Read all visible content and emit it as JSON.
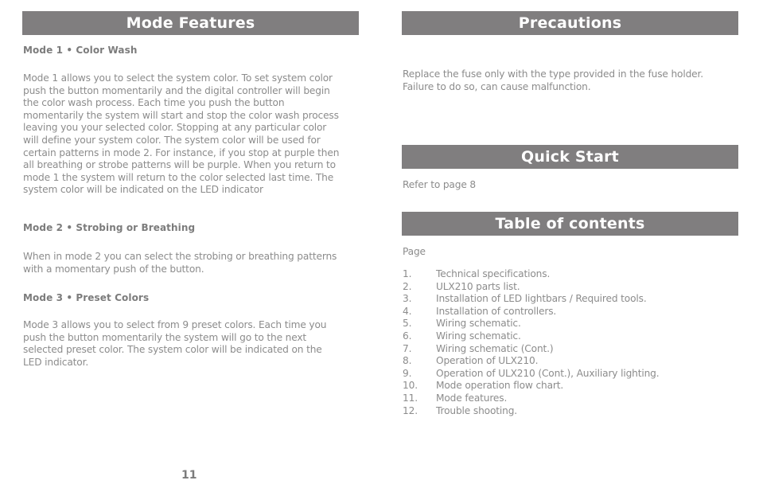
{
  "left_page": {
    "title": "Mode Features",
    "modes": [
      {
        "heading": "Mode 1 • Color Wash",
        "body": "Mode 1 allows you to select the system color. To set system color push the button momentarily and the digital controller will begin the color wash process. Each time you push the button momentarily the system will start and stop the color wash process leaving you your selected color. Stopping at any particular color will define your system color. The system color will be used for certain patterns in mode 2. For instance, if you stop at purple then all breathing or strobe patterns will be purple. When you return to mode 1 the system will return to the color selected last time. The system color will be indicated on the LED indicator"
      },
      {
        "heading": "Mode 2 • Strobing or Breathing",
        "body": "When in mode 2 you can select the strobing or breathing patterns with a momentary push of the button."
      },
      {
        "heading": "Mode 3 • Preset Colors",
        "body": "Mode 3 allows you to select from 9 preset colors. Each time you push the button momentarily the system will go to the next selected preset color. The system color will be indicated on the LED indicator."
      }
    ],
    "page_number": "11"
  },
  "right_page": {
    "precautions": {
      "title": "Precautions",
      "body": "Replace the fuse only with the type provided in the fuse holder. Failure to do so, can cause malfunction."
    },
    "quick_start": {
      "title": "Quick Start",
      "body": "Refer to page 8"
    },
    "toc": {
      "title": "Table of contents",
      "page_label": "Page",
      "items": [
        {
          "num": "1.",
          "label": "Technical specifications."
        },
        {
          "num": "2.",
          "label": "ULX210 parts list."
        },
        {
          "num": "3.",
          "label": "Installation of LED lightbars / Required tools."
        },
        {
          "num": "4.",
          "label": "Installation of controllers."
        },
        {
          "num": "5.",
          "label": "Wiring schematic."
        },
        {
          "num": "6.",
          "label": "Wiring schematic."
        },
        {
          "num": "7.",
          "label": "Wiring schematic (Cont.)"
        },
        {
          "num": "8.",
          "label": "Operation of ULX210."
        },
        {
          "num": "9.",
          "label": "Operation of ULX210 (Cont.), Auxiliary lighting."
        },
        {
          "num": "10.",
          "label": "Mode operation flow chart."
        },
        {
          "num": "11.",
          "label": "Mode features."
        },
        {
          "num": "12.",
          "label": "Trouble shooting."
        }
      ]
    }
  },
  "colors": {
    "header_bar": "#807e7f",
    "header_text": "#ffffff",
    "body_text": "#8c8c8c"
  }
}
